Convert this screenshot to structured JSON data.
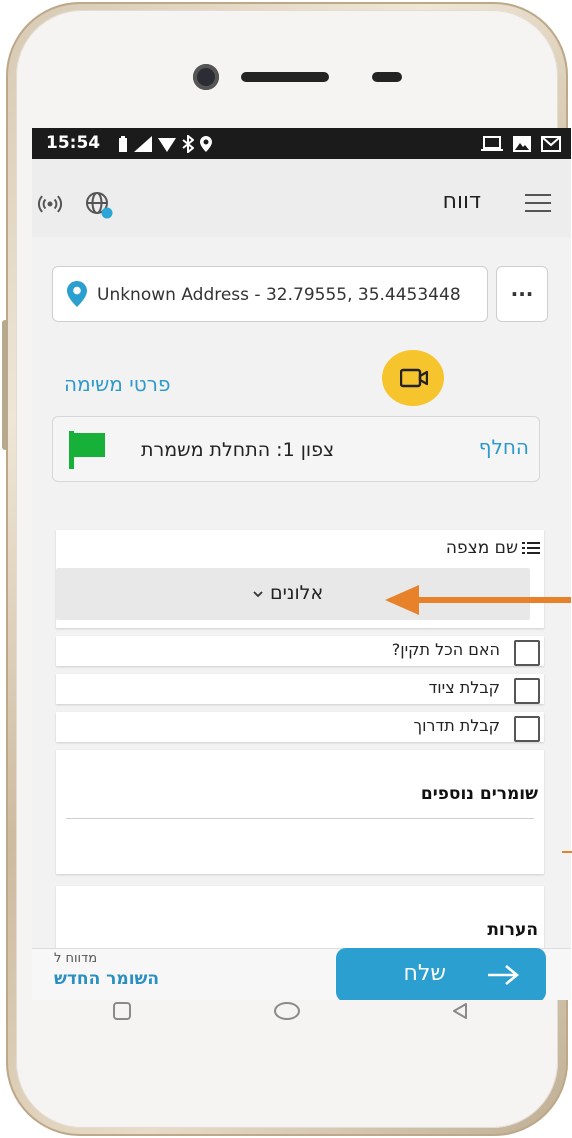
{
  "status_bar": {
    "time": "15:54"
  },
  "app_bar": {
    "title": "דווח"
  },
  "location": {
    "address": "Unknown Address - 32.79555, 35.4453448",
    "more_label": "..."
  },
  "task": {
    "details_link": "פרטי משימה"
  },
  "checkpoint": {
    "name": "צפון 1: התחלת משמרת",
    "replace_label": "החלף",
    "flag_color": "#17b13a"
  },
  "post": {
    "label": "שם מצפה",
    "selected_value": "אלונים"
  },
  "checklist": [
    {
      "label": "האם הכל תקין?"
    },
    {
      "label": "קבלת ציוד"
    },
    {
      "label": "קבלת תדרוך"
    }
  ],
  "additional_guards": {
    "label": "שומרים נוספים"
  },
  "notes": {
    "label": "הערות"
  },
  "footer": {
    "reported_caption": "מדווח ל",
    "recipient": "השומר החדש",
    "send_label": "שלח"
  },
  "colors": {
    "accent": "#2a9fd0",
    "link": "#2d9acb",
    "video_button": "#f6c42c",
    "annotation_arrow": "#e8822a"
  }
}
